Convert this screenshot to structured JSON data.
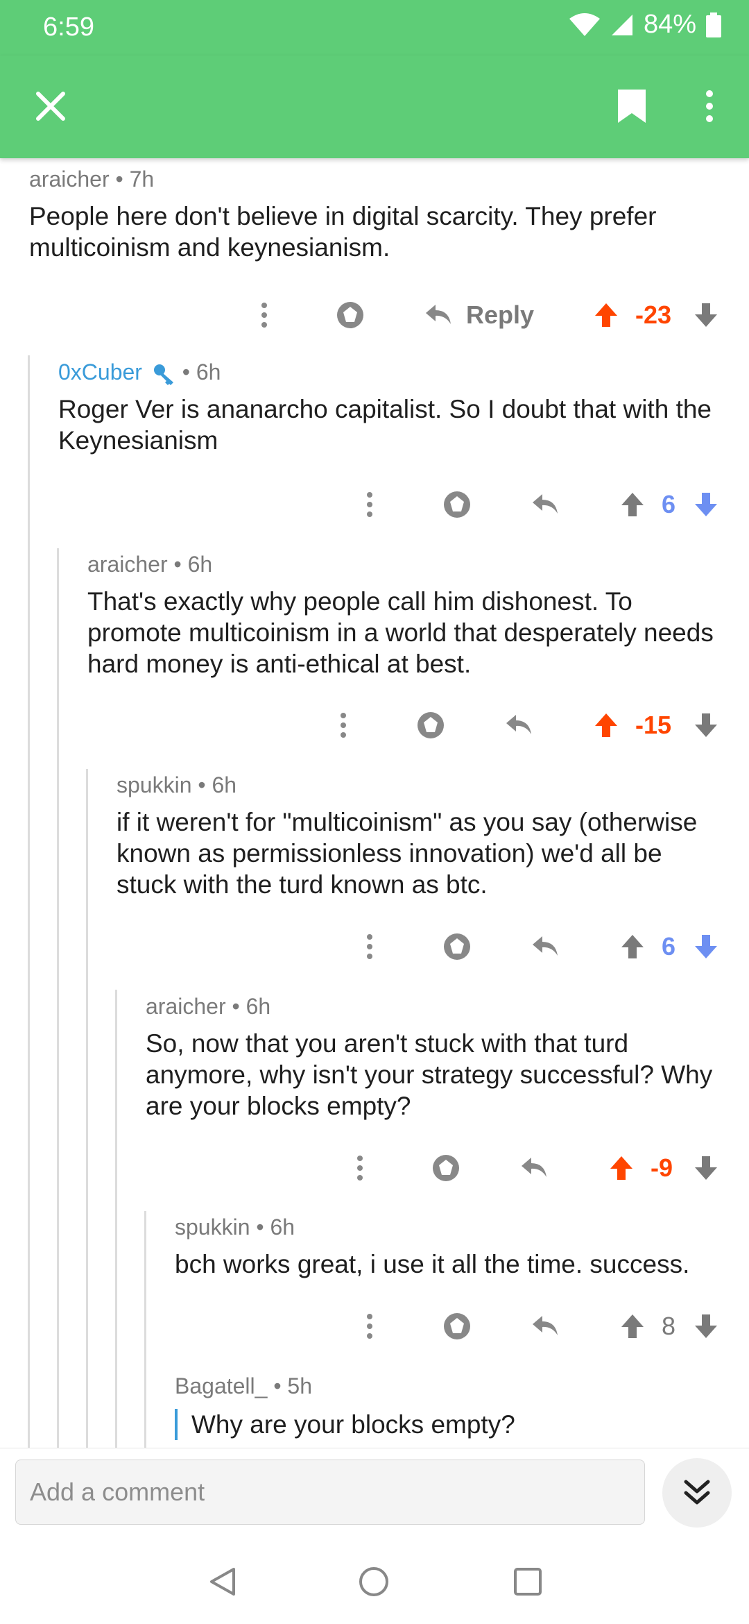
{
  "status_bar": {
    "time": "6:59",
    "battery": "84%"
  },
  "app_bar": {
    "close_icon": "close-icon",
    "bookmark_icon": "bookmark-icon",
    "more_icon": "more-vert-icon"
  },
  "colors": {
    "accent": "#5ecd77",
    "upvoted": "#ff4500",
    "downvoted": "#6d8ff2",
    "neutral": "#7a7a7a",
    "user_link": "#3a9bd9"
  },
  "comments": [
    {
      "author": "araicher",
      "time": "7h",
      "body": "People here don't believe in digital scarcity. They prefer multicoinism and keynesianism.",
      "reply_label": "Reply",
      "score": "-23",
      "vote": "up"
    },
    {
      "author": "0xCuber",
      "time": "6h",
      "body": "Roger Ver is ananarcho capitalist. So I doubt that with the Keynesianism",
      "score": "6",
      "vote": "down"
    },
    {
      "author": "araicher",
      "time": "6h",
      "body": "That's exactly why people call him dishonest. To promote multicoinism in a world that desperately needs hard money is anti-ethical at best.",
      "score": "-15",
      "vote": "up"
    },
    {
      "author": "spukkin",
      "time": "6h",
      "body": "if it weren't for \"multicoinism\" as you say (otherwise known as permissionless innovation) we'd all be stuck with the turd known as btc.",
      "score": "6",
      "vote": "down"
    },
    {
      "author": "araicher",
      "time": "6h",
      "body": "So, now that you aren't stuck with that turd anymore, why isn't your strategy successful? Why are your blocks empty?",
      "score": "-9",
      "vote": "up"
    },
    {
      "author": "spukkin",
      "time": "6h",
      "body": "bch works great, i use it all the time. success.",
      "score": "8",
      "vote": "none"
    },
    {
      "author": "Bagatell_",
      "time": "5h",
      "quote": "Why are your blocks empty?"
    }
  ],
  "composer": {
    "placeholder": "Add a comment"
  }
}
